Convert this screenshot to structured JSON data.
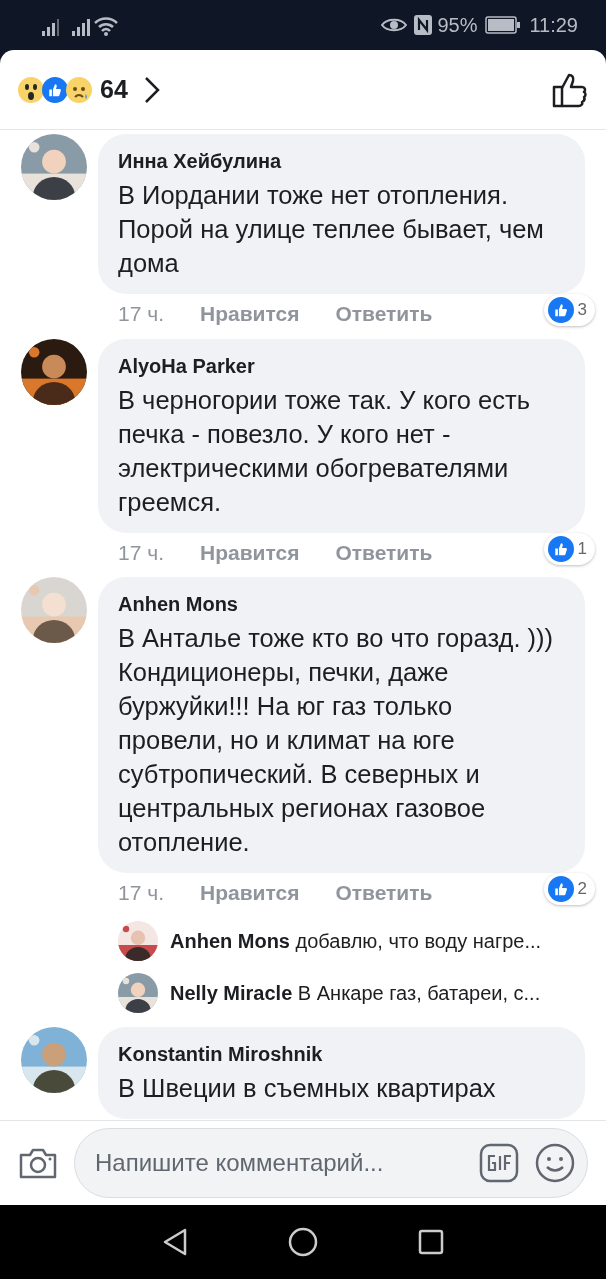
{
  "status_bar": {
    "battery": "95%",
    "time": "11:29"
  },
  "header": {
    "reaction_count": "64"
  },
  "comments": [
    {
      "author": "Инна Хейбулина",
      "text": "В Иордании тоже нет отопления. Порой на улице теплее бывает, чем дома",
      "time": "17 ч.",
      "like_label": "Нравится",
      "reply_label": "Ответить",
      "likes": "3"
    },
    {
      "author": "AlyoHa Parker",
      "text": "В черногории тоже так. У кого есть печка - повезло. У кого нет - электрическими обогревателями греемся.",
      "time": "17 ч.",
      "like_label": "Нравится",
      "reply_label": "Ответить",
      "likes": "1"
    },
    {
      "author": "Anhen Mons",
      "text": "В Анталье тоже кто во что горазд. ))) Кондиционеры, печки, даже буржуйки!!! На юг газ только провели, но и климат на юге субтропический. В северных и центральных регионах газовое отопление.",
      "time": "17 ч.",
      "like_label": "Нравится",
      "reply_label": "Ответить",
      "likes": "2",
      "replies": [
        {
          "author": "Anhen Mons",
          "text": "добавлю, что воду нагре..."
        },
        {
          "author": "Nelly Miracle",
          "text": "В Анкаре газ, батареи, с..."
        }
      ]
    },
    {
      "author": "Konstantin Miroshnik",
      "text": "В Швеции в съемных квартирах"
    }
  ],
  "composer": {
    "placeholder": "Напишите комментарий..."
  }
}
